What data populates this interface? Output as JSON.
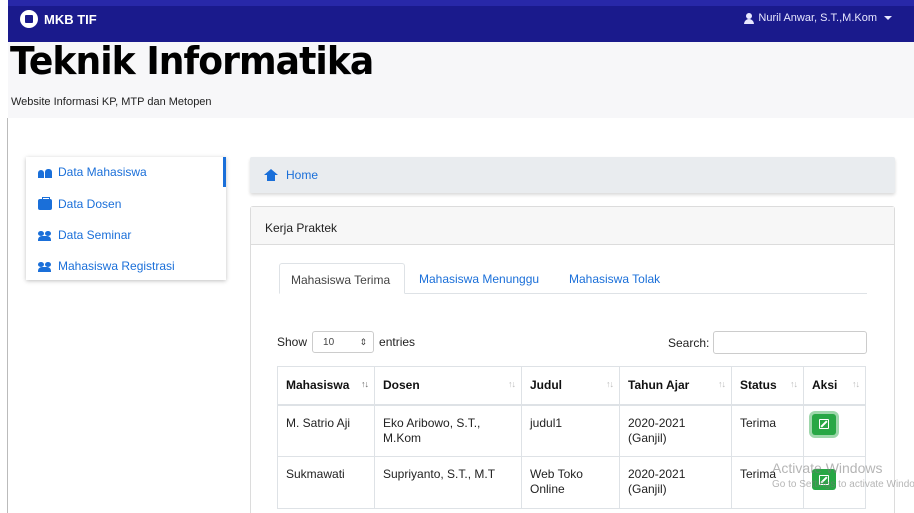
{
  "navbar": {
    "brand": "MKB TIF",
    "user": "Nuril Anwar, S.T.,M.Kom"
  },
  "header": {
    "title": "Teknik Informatika",
    "subtitle": "Website Informasi KP, MTP dan Metopen"
  },
  "sidebar": {
    "items": [
      {
        "label": "Data Mahasiswa",
        "icon": "users-icon"
      },
      {
        "label": "Data Dosen",
        "icon": "briefcase-icon"
      },
      {
        "label": "Data Seminar",
        "icon": "group-icon"
      },
      {
        "label": "Mahasiswa Registrasi",
        "icon": "group-icon"
      }
    ]
  },
  "breadcrumb": {
    "home": "Home"
  },
  "card": {
    "title": "Kerja Praktek",
    "tabs": [
      "Mahasiswa Terima",
      "Mahasiswa Menunggu",
      "Mahasiswa Tolak"
    ],
    "length": {
      "show": "Show",
      "value": "10",
      "entries": "entries"
    },
    "search": {
      "label": "Search:",
      "value": ""
    },
    "table": {
      "headers": [
        "Mahasiswa",
        "Dosen",
        "Judul",
        "Tahun Ajar",
        "Status",
        "Aksi"
      ],
      "rows": [
        [
          "M. Satrio Aji",
          "Eko Aribowo, S.T., M.Kom",
          "judul1",
          "2020-2021 (Ganjil)",
          "Terima"
        ],
        [
          "Sukmawati",
          "Supriyanto, S.T., M.T",
          "Web Toko Online",
          "2020-2021 (Ganjil)",
          "Terima"
        ]
      ]
    }
  },
  "watermark": {
    "line1": "Activate Windows",
    "line2": "Go to Settings to activate Windows."
  },
  "colors": {
    "navbar": "#1a1a8c",
    "link": "#1a6fd9",
    "success": "#28a745"
  }
}
